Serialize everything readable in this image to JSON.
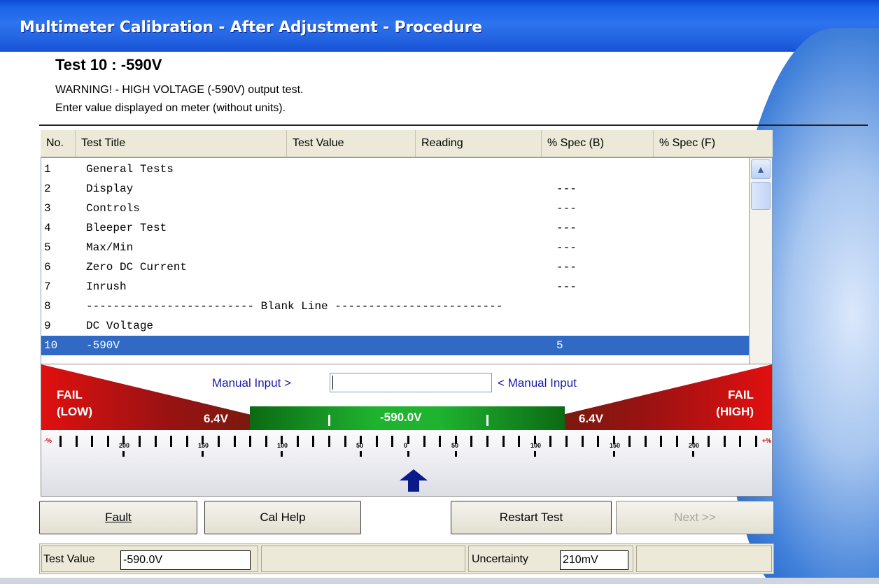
{
  "window": {
    "title": "Multimeter Calibration - After Adjustment - Procedure"
  },
  "test": {
    "heading": "Test 10 : -590V",
    "warning": "WARNING! - HIGH VOLTAGE (-590V) output test.",
    "instruction": "Enter value displayed on meter (without units)."
  },
  "grid": {
    "columns": [
      "No.",
      "Test Title",
      "Test Value",
      "Reading",
      "% Spec (B)",
      "% Spec (F)"
    ],
    "rows": [
      {
        "no": "1",
        "title": "General Tests",
        "spec_b": ""
      },
      {
        "no": "2",
        "title": "Display",
        "spec_b": "---"
      },
      {
        "no": "3",
        "title": "Controls",
        "spec_b": "---"
      },
      {
        "no": "4",
        "title": "Bleeper Test",
        "spec_b": "---"
      },
      {
        "no": "5",
        "title": "Max/Min",
        "spec_b": "---"
      },
      {
        "no": "6",
        "title": "Zero DC Current",
        "spec_b": "---"
      },
      {
        "no": "7",
        "title": "Inrush",
        "spec_b": "---"
      },
      {
        "no": "8",
        "title": "------------------------- Blank Line -------------------------",
        "spec_b": ""
      },
      {
        "no": "9",
        "title": "DC Voltage",
        "spec_b": ""
      },
      {
        "no": "10",
        "title": "-590V",
        "spec_b": "5"
      }
    ],
    "selected_index": 9
  },
  "gauge": {
    "fail_low": [
      "FAIL",
      "(LOW)"
    ],
    "fail_high": [
      "FAIL",
      "(HIGH)"
    ],
    "low_limit": "6.4V",
    "high_limit": "6.4V",
    "center_value": "-590.0V",
    "manual_left": "Manual Input >",
    "manual_right": "< Manual Input",
    "manual_value": "",
    "scale_labels": [
      "200",
      "150",
      "100",
      "50",
      "0",
      "50",
      "100",
      "150",
      "200"
    ],
    "left_end": "-%",
    "right_end": "+%"
  },
  "buttons": {
    "fault": "Fault",
    "cal_help": "Cal Help",
    "restart": "Restart Test",
    "next": "Next >>"
  },
  "status": {
    "test_value_label": "Test Value",
    "test_value": "-590.0V",
    "uncertainty_label": "Uncertainty",
    "uncertainty": "210mV"
  },
  "colors": {
    "title_bar": "#2e74ee",
    "selection": "#316ac5",
    "ok_zone": "#1fb330",
    "fail_zone": "#e01010"
  }
}
